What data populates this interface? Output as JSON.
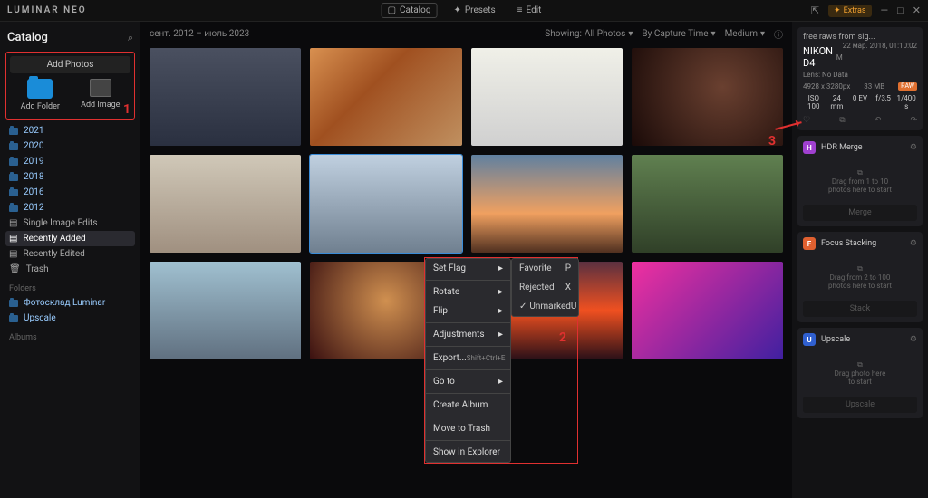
{
  "app": {
    "logo": "LUMINAR NEO"
  },
  "topTabs": {
    "catalog": "Catalog",
    "presets": "Presets",
    "edit": "Edit"
  },
  "extras": "Extras",
  "sidebar": {
    "title": "Catalog",
    "addPhotos": "Add Photos",
    "addFolder": "Add Folder",
    "addImage": "Add Image",
    "years": [
      "2021",
      "2020",
      "2019",
      "2018",
      "2016",
      "2012"
    ],
    "shortcuts": {
      "singleEdits": "Single Image Edits",
      "recentlyAdded": "Recently Added",
      "recentlyEdited": "Recently Edited",
      "trash": "Trash"
    },
    "foldersLabel": "Folders",
    "folders": [
      "Фотосклад Luminar",
      "Upscale"
    ],
    "albumsLabel": "Albums"
  },
  "main": {
    "dateRange": "сент. 2012 – июль 2023",
    "showing": "Showing:",
    "allPhotos": "All Photos",
    "sortBy": "By Capture Time",
    "size": "Medium"
  },
  "context": {
    "setFlag": "Set Flag",
    "rotate": "Rotate",
    "flip": "Flip",
    "adjustments": "Adjustments",
    "export": "Export...",
    "exportShortcut": "Shift+Ctrl+E",
    "goTo": "Go to",
    "createAlbum": "Create Album",
    "moveToTrash": "Move to Trash",
    "showInExplorer": "Show in Explorer",
    "submenu": {
      "favorite": "Favorite",
      "favKey": "P",
      "rejected": "Rejected",
      "rejKey": "X",
      "unmarked": "Unmarked",
      "unKey": "U"
    }
  },
  "info": {
    "title": "free raws from sig...",
    "date": "22 мар. 2018, 01:10:02",
    "camera": "NIKON D4",
    "mode": "M",
    "lens": "Lens: No Data",
    "dims": "4928 x 3280px",
    "size": "33 MB",
    "format": "RAW",
    "iso": "ISO 100",
    "focal": "24 mm",
    "ev": "0 EV",
    "aperture": "f/3,5",
    "shutter": "1/400 s"
  },
  "tools": {
    "hdr": {
      "name": "HDR Merge",
      "hint": "Drag from 1 to 10\nphotos here to start",
      "btn": "Merge"
    },
    "focus": {
      "name": "Focus Stacking",
      "hint": "Drag from 2 to 100\nphotos here to start",
      "btn": "Stack"
    },
    "upscale": {
      "name": "Upscale",
      "hint": "Drag photo here\nto start",
      "btn": "Upscale"
    }
  },
  "annotations": {
    "a1": "1",
    "a2": "2",
    "a3": "3"
  }
}
